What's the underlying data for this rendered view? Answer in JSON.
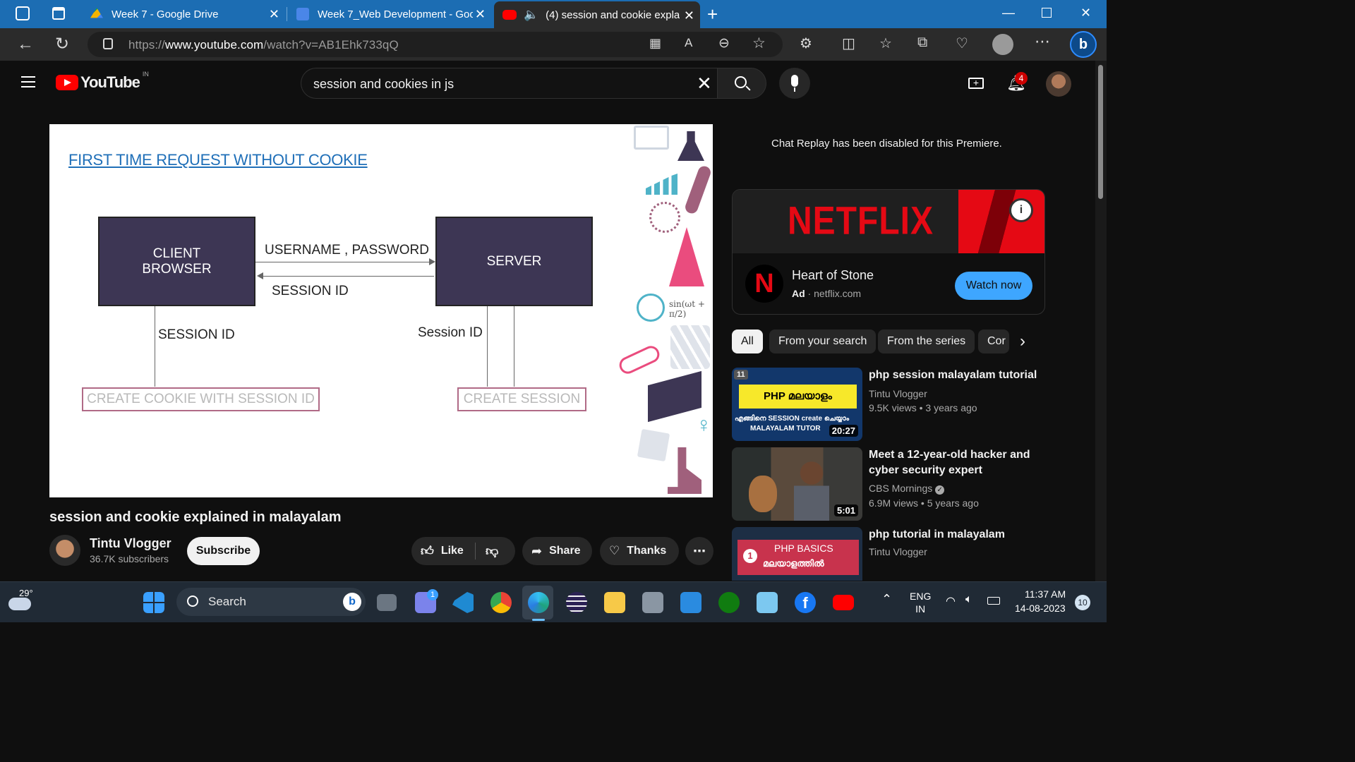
{
  "browser": {
    "tabs": [
      {
        "title": "Week 7 - Google Drive",
        "icon": "google-drive-icon"
      },
      {
        "title": "Week 7_Web Development - Goo",
        "icon": "google-docs-icon"
      },
      {
        "title": "(4) session and cookie expla",
        "icon": "youtube-icon",
        "active": true
      }
    ],
    "url_prefix": "https://",
    "url_domain": "www.youtube.com",
    "url_path": "/watch?v=AB1Ehk733qQ"
  },
  "youtube": {
    "logo_text": "YouTube",
    "country_code": "IN",
    "search_query": "session and cookies in js",
    "notification_count": "4"
  },
  "video": {
    "slide_heading": "FIRST TIME REQUEST WITHOUT COOKIE",
    "client_box": "CLIENT\nBROWSER",
    "server_box": "SERVER",
    "arrow_username": "USERNAME , PASSWORD",
    "arrow_session_top": "SESSION ID",
    "arrow_session_left": "SESSION ID",
    "arrow_session_right": "Session ID",
    "create_cookie": "CREATE COOKIE WITH SESSION ID",
    "create_session": "CREATE SESSION",
    "deco_formula": "sin(ωt + π/2)"
  },
  "details": {
    "title": "session and cookie explained in malayalam",
    "channel": "Tintu Vlogger",
    "subscribers": "36.7K subscribers",
    "subscribe_label": "Subscribe",
    "like_label": "Like",
    "share_label": "Share",
    "thanks_label": "Thanks"
  },
  "sidebar": {
    "chat_notice": "Chat Replay has been disabled for this Premiere.",
    "ad": {
      "brand_banner": "NETFLIX",
      "title": "Heart of Stone",
      "ad_label": "Ad",
      "domain": "netflix.com",
      "cta": "Watch now"
    },
    "chips": [
      "All",
      "From your search",
      "From the series",
      "Cor"
    ],
    "recommendations": [
      {
        "title": "php session malayalam tutorial",
        "channel": "Tintu Vlogger",
        "views": "9.5K views",
        "age": "3 years ago",
        "duration": "20:27",
        "thumb_badge": "11",
        "thumb_main": "PHP മലയാളം",
        "thumb_sub1": "എങ്ങിനെ SESSION create ചെയ്യാം",
        "thumb_sub2": "MALAYALAM TUTOR"
      },
      {
        "title": "Meet a 12-year-old hacker and cyber security expert",
        "channel": "CBS Mornings",
        "views": "6.9M views",
        "age": "5 years ago",
        "duration": "5:01"
      },
      {
        "title": "php tutorial in malayalam",
        "channel": "Tintu Vlogger",
        "thumb_main": "PHP BASICS",
        "thumb_sub1": "മലയാളത്തിൽ",
        "thumb_badge": "1"
      }
    ]
  },
  "taskbar": {
    "weather_temp": "29°",
    "search_placeholder": "Search",
    "lang_top": "ENG",
    "lang_bottom": "IN",
    "time": "11:37 AM",
    "date": "14-08-2023",
    "notification_count": "10",
    "teams_badge": "1"
  }
}
